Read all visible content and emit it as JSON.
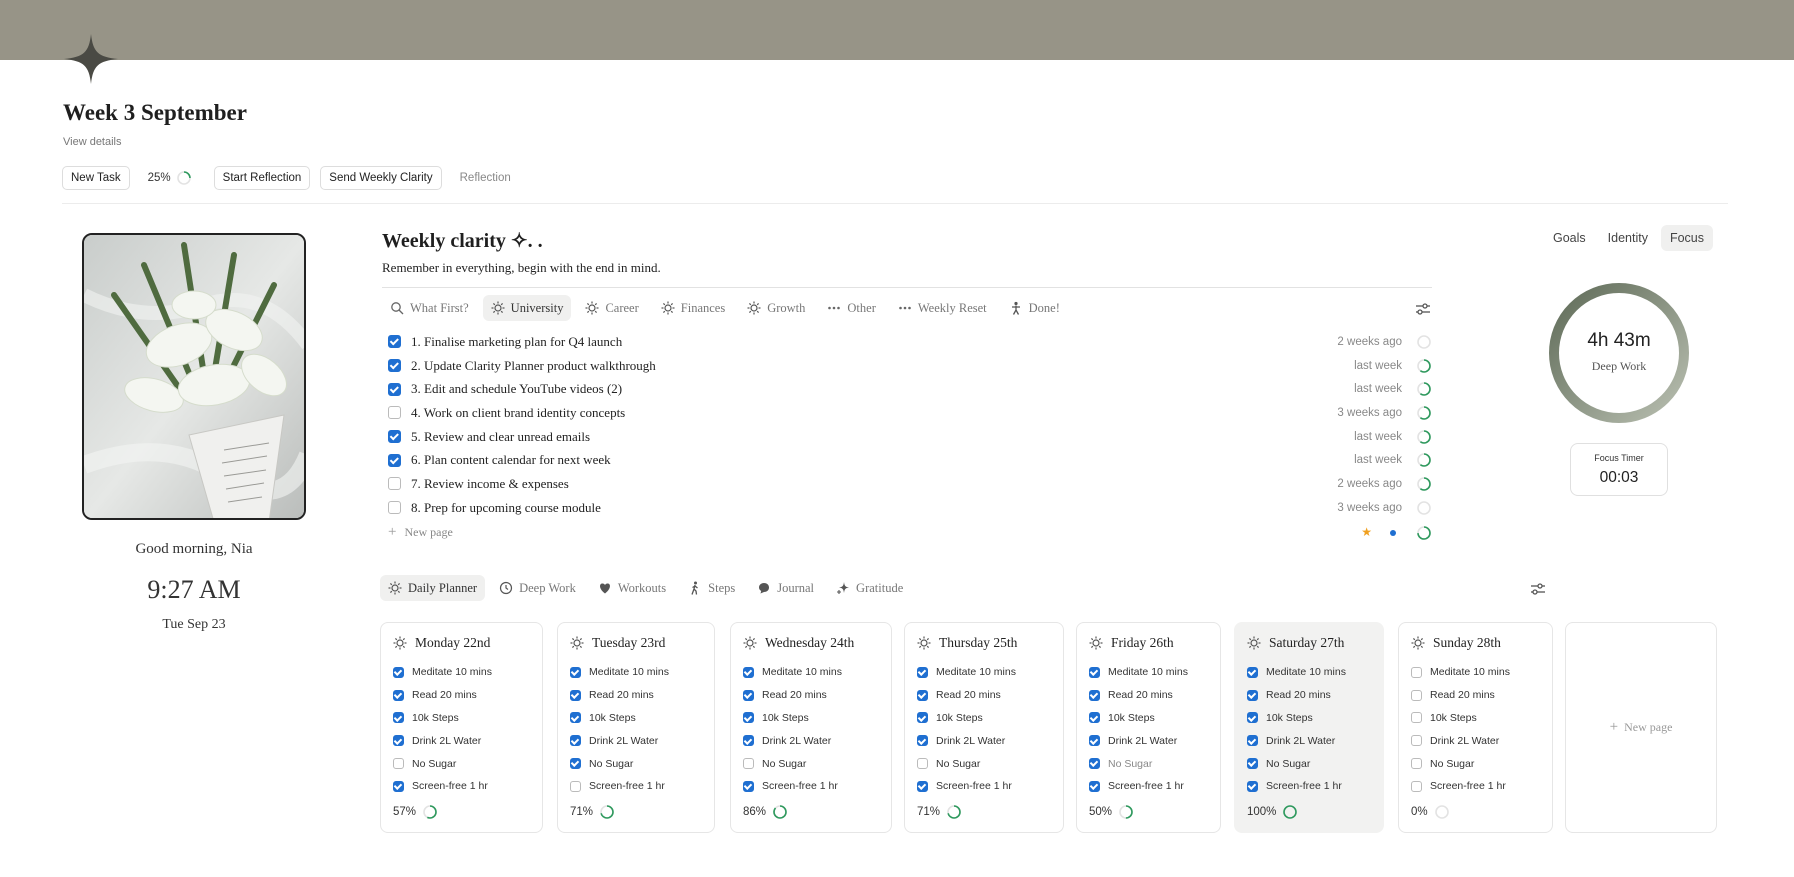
{
  "banner_color": "#979487",
  "accent_green": "#2f9a5e",
  "checkbox_blue": "#1f6fd1",
  "header": {
    "title": "Week 3 September",
    "view_details": "View details"
  },
  "toolbar": {
    "new_task": "New Task",
    "progress_label": "25%",
    "progress": 0.25,
    "start_reflection": "Start Reflection",
    "send_weekly_clarity": "Send Weekly Clarity",
    "reflection": "Reflection"
  },
  "left": {
    "greeting": "Good morning, Nia",
    "time": "9:27 AM",
    "date": "Tue Sep 23"
  },
  "weekly": {
    "title": "Weekly clarity ✧. .",
    "subtitle": "Remember in everything, begin with the end in mind.",
    "filters": [
      {
        "label": "What First?",
        "icon": "search-icon"
      },
      {
        "label": "University",
        "icon": "sun-icon",
        "active": true
      },
      {
        "label": "Career",
        "icon": "sun-icon"
      },
      {
        "label": "Finances",
        "icon": "sun-icon"
      },
      {
        "label": "Growth",
        "icon": "sun-icon"
      },
      {
        "label": "Other",
        "icon": "dots-icon"
      },
      {
        "label": "Weekly Reset",
        "icon": "dots-icon"
      },
      {
        "label": "Done!",
        "icon": "person-icon"
      }
    ],
    "tasks": [
      {
        "label": "1. Finalise marketing plan for Q4 launch",
        "when": "2 weeks ago",
        "checked": true,
        "progress": 0
      },
      {
        "label": "2. Update Clarity Planner product walkthrough",
        "when": "last week",
        "checked": true,
        "progress": 0.6
      },
      {
        "label": "3. Edit and schedule YouTube videos (2)",
        "when": "last week",
        "checked": true,
        "progress": 0.6
      },
      {
        "label": "4. Work on client brand identity concepts",
        "when": "3 weeks ago",
        "checked": false,
        "progress": 0.6
      },
      {
        "label": "5. Review and clear unread emails",
        "when": "last week",
        "checked": true,
        "progress": 0.6
      },
      {
        "label": "6. Plan content calendar for next week",
        "when": "last week",
        "checked": true,
        "progress": 0.6
      },
      {
        "label": "7. Review income & expenses",
        "when": "2 weeks ago",
        "checked": false,
        "progress": 0.6
      },
      {
        "label": "8. Prep for upcoming course module",
        "when": "3 weeks ago",
        "checked": false,
        "progress": 0
      }
    ],
    "new_page": "New page"
  },
  "right": {
    "tabs": [
      "Goals",
      "Identity",
      "Focus"
    ],
    "active_tab": "Focus",
    "focus_value": "4h 43m",
    "focus_label": "Deep Work",
    "timer_label": "Focus Timer",
    "timer_value": "00:03"
  },
  "planner": {
    "tabs": [
      {
        "label": "Daily Planner",
        "icon": "sun-icon",
        "active": true
      },
      {
        "label": "Deep Work",
        "icon": "clock-icon"
      },
      {
        "label": "Workouts",
        "icon": "heart-icon"
      },
      {
        "label": "Steps",
        "icon": "walk-icon"
      },
      {
        "label": "Journal",
        "icon": "chat-icon"
      },
      {
        "label": "Gratitude",
        "icon": "sparkle-icon"
      }
    ],
    "habit_names": [
      "Meditate 10 mins",
      "Read 20 mins",
      "10k Steps",
      "Drink 2L Water",
      "No Sugar",
      "Screen-free 1 hr"
    ],
    "days": [
      {
        "name": "Monday 22nd",
        "checks": [
          true,
          true,
          true,
          true,
          false,
          true
        ],
        "pct_label": "57%",
        "pct": 0.57
      },
      {
        "name": "Tuesday 23rd",
        "checks": [
          true,
          true,
          true,
          true,
          true,
          false
        ],
        "pct_label": "71%",
        "pct": 0.71
      },
      {
        "name": "Wednesday 24th",
        "checks": [
          true,
          true,
          true,
          true,
          false,
          true
        ],
        "pct_label": "86%",
        "pct": 0.86
      },
      {
        "name": "Thursday 25th",
        "checks": [
          true,
          true,
          true,
          true,
          false,
          true
        ],
        "pct_label": "71%",
        "pct": 0.71
      },
      {
        "name": "Friday 26th",
        "checks": [
          true,
          true,
          true,
          true,
          true,
          true
        ],
        "pct_label": "50%",
        "pct": 0.5
      },
      {
        "name": "Saturday 27th",
        "checks": [
          true,
          true,
          true,
          true,
          true,
          true
        ],
        "pct_label": "100%",
        "pct": 1.0,
        "today": true
      },
      {
        "name": "Sunday 28th",
        "checks": [
          false,
          false,
          false,
          false,
          false,
          false
        ],
        "pct_label": "0%",
        "pct": 0
      }
    ],
    "new_page": "New page"
  }
}
